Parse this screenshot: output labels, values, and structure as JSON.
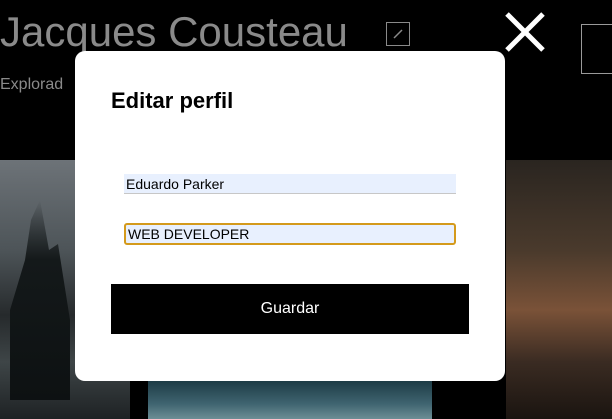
{
  "profile": {
    "name": "Jacques Cousteau",
    "role": "Explorad"
  },
  "icons": {
    "close": "close-icon",
    "edit": "pencil-icon"
  },
  "modal": {
    "title": "Editar perfil",
    "name_value": "Eduardo Parker",
    "job_value": "WEB DEVELOPER",
    "submit_label": "Guardar"
  },
  "colors": {
    "overlay": "#000000",
    "focus_border": "#d49a1c",
    "autofill_bg": "#e8f0fe",
    "button_bg": "#000000"
  }
}
